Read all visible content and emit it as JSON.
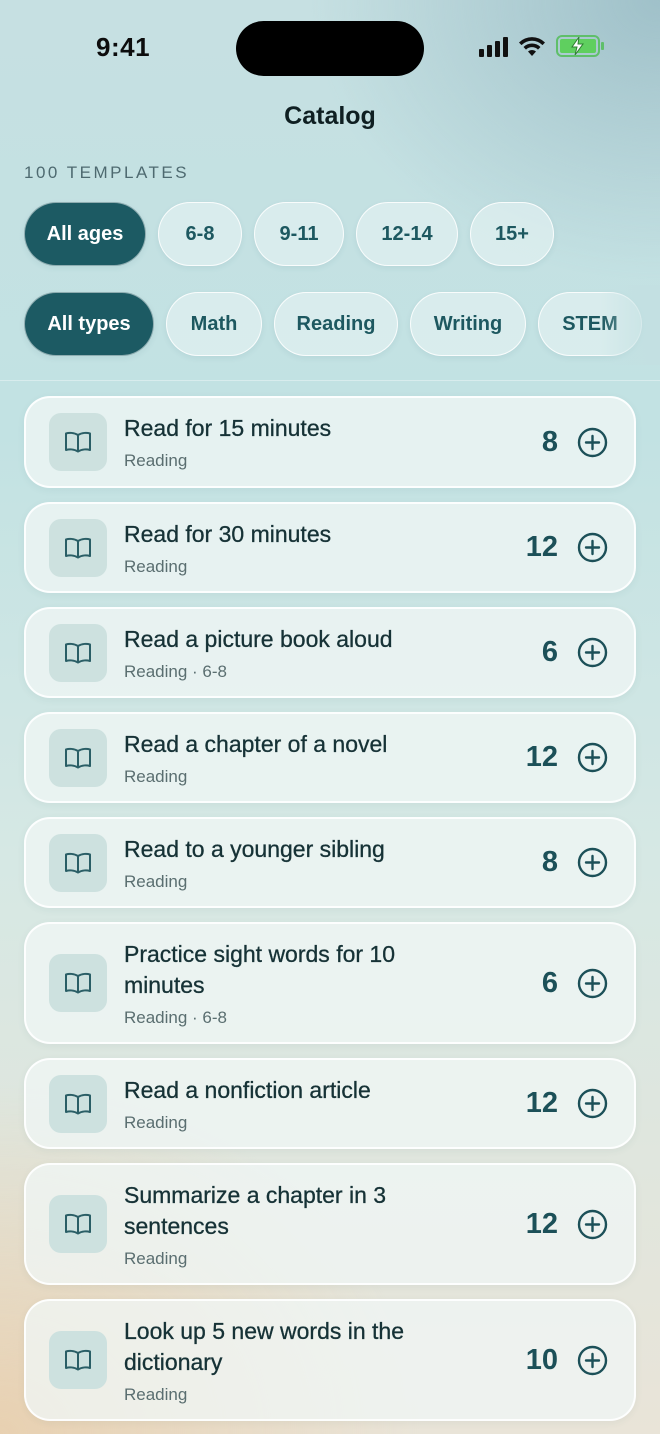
{
  "status": {
    "time": "9:41"
  },
  "nav": {
    "title": "Catalog"
  },
  "count_label": "100 TEMPLATES",
  "age_filters": [
    {
      "label": "All ages",
      "selected": true
    },
    {
      "label": "6-8",
      "selected": false
    },
    {
      "label": "9-11",
      "selected": false
    },
    {
      "label": "12-14",
      "selected": false
    },
    {
      "label": "15+",
      "selected": false
    }
  ],
  "type_filters": [
    {
      "label": "All types",
      "selected": true
    },
    {
      "label": "Math",
      "selected": false
    },
    {
      "label": "Reading",
      "selected": false
    },
    {
      "label": "Writing",
      "selected": false
    },
    {
      "label": "STEM",
      "selected": false
    }
  ],
  "templates": [
    {
      "title": "Read for 15 minutes",
      "subtitle": "Reading",
      "points": "8",
      "icon": "book-icon"
    },
    {
      "title": "Read for 30 minutes",
      "subtitle": "Reading",
      "points": "12",
      "icon": "book-icon"
    },
    {
      "title": "Read a picture book aloud",
      "subtitle": "Reading · 6-8",
      "points": "6",
      "icon": "book-icon"
    },
    {
      "title": "Read a chapter of a novel",
      "subtitle": "Reading",
      "points": "12",
      "icon": "book-icon"
    },
    {
      "title": "Read to a younger sibling",
      "subtitle": "Reading",
      "points": "8",
      "icon": "book-icon"
    },
    {
      "title": "Practice sight words for 10 minutes",
      "subtitle": "Reading · 6-8",
      "points": "6",
      "icon": "book-icon"
    },
    {
      "title": "Read a nonfiction article",
      "subtitle": "Reading",
      "points": "12",
      "icon": "book-icon"
    },
    {
      "title": "Summarize a chapter in 3 sentences",
      "subtitle": "Reading",
      "points": "12",
      "icon": "book-icon"
    },
    {
      "title": "Look up 5 new words in the dictionary",
      "subtitle": "Reading",
      "points": "10",
      "icon": "book-icon"
    }
  ],
  "colors": {
    "accent": "#1c5a63",
    "battery": "#5fcf5f"
  }
}
